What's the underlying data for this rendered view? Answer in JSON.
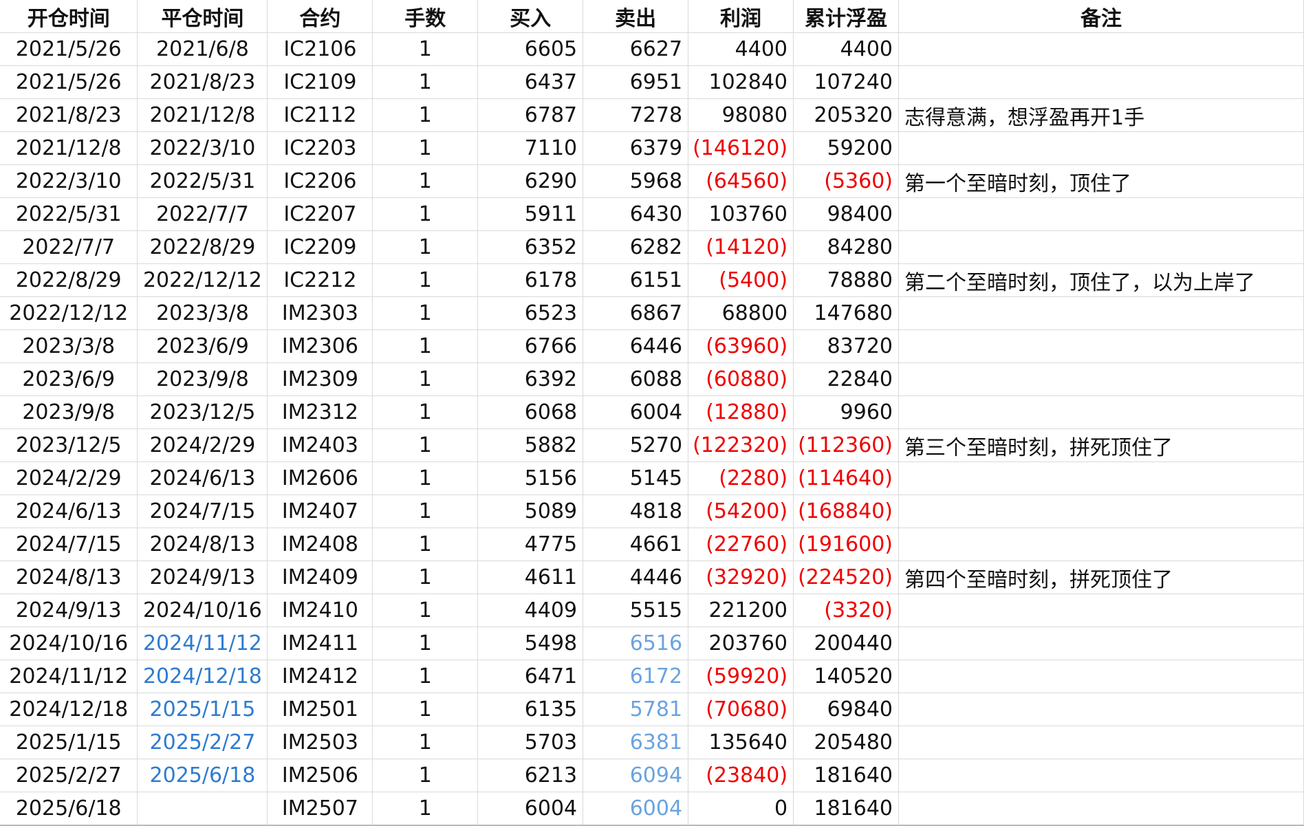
{
  "headers": [
    "开仓时间",
    "平仓时间",
    "合约",
    "手数",
    "买入",
    "卖出",
    "利润",
    "累计浮盈",
    "备注"
  ],
  "rows": [
    {
      "open": "2021/5/26",
      "close": "2021/6/8",
      "contract": "IC2106",
      "lots": "1",
      "buy": "6605",
      "sell": "6627",
      "profit": "4400",
      "cum": "4400",
      "note": ""
    },
    {
      "open": "2021/5/26",
      "close": "2021/8/23",
      "contract": "IC2109",
      "lots": "1",
      "buy": "6437",
      "sell": "6951",
      "profit": "102840",
      "cum": "107240",
      "note": ""
    },
    {
      "open": "2021/8/23",
      "close": "2021/12/8",
      "contract": "IC2112",
      "lots": "1",
      "buy": "6787",
      "sell": "7278",
      "profit": "98080",
      "cum": "205320",
      "note": "志得意满，想浮盈再开1手"
    },
    {
      "open": "2021/12/8",
      "close": "2022/3/10",
      "contract": "IC2203",
      "lots": "1",
      "buy": "7110",
      "sell": "6379",
      "profit": "(146120)",
      "cum": "59200",
      "note": ""
    },
    {
      "open": "2022/3/10",
      "close": "2022/5/31",
      "contract": "IC2206",
      "lots": "1",
      "buy": "6290",
      "sell": "5968",
      "profit": "(64560)",
      "cum": "(5360)",
      "note": "第一个至暗时刻，顶住了"
    },
    {
      "open": "2022/5/31",
      "close": "2022/7/7",
      "contract": "IC2207",
      "lots": "1",
      "buy": "5911",
      "sell": "6430",
      "profit": "103760",
      "cum": "98400",
      "note": ""
    },
    {
      "open": "2022/7/7",
      "close": "2022/8/29",
      "contract": "IC2209",
      "lots": "1",
      "buy": "6352",
      "sell": "6282",
      "profit": "(14120)",
      "cum": "84280",
      "note": ""
    },
    {
      "open": "2022/8/29",
      "close": "2022/12/12",
      "contract": "IC2212",
      "lots": "1",
      "buy": "6178",
      "sell": "6151",
      "profit": "(5400)",
      "cum": "78880",
      "note": "第二个至暗时刻，顶住了，以为上岸了"
    },
    {
      "open": "2022/12/12",
      "close": "2023/3/8",
      "contract": "IM2303",
      "lots": "1",
      "buy": "6523",
      "sell": "6867",
      "profit": "68800",
      "cum": "147680",
      "note": ""
    },
    {
      "open": "2023/3/8",
      "close": "2023/6/9",
      "contract": "IM2306",
      "lots": "1",
      "buy": "6766",
      "sell": "6446",
      "profit": "(63960)",
      "cum": "83720",
      "note": ""
    },
    {
      "open": "2023/6/9",
      "close": "2023/9/8",
      "contract": "IM2309",
      "lots": "1",
      "buy": "6392",
      "sell": "6088",
      "profit": "(60880)",
      "cum": "22840",
      "note": ""
    },
    {
      "open": "2023/9/8",
      "close": "2023/12/5",
      "contract": "IM2312",
      "lots": "1",
      "buy": "6068",
      "sell": "6004",
      "profit": "(12880)",
      "cum": "9960",
      "note": ""
    },
    {
      "open": "2023/12/5",
      "close": "2024/2/29",
      "contract": "IM2403",
      "lots": "1",
      "buy": "5882",
      "sell": "5270",
      "profit": "(122320)",
      "cum": "(112360)",
      "note": "第三个至暗时刻，拼死顶住了"
    },
    {
      "open": "2024/2/29",
      "close": "2024/6/13",
      "contract": "IM2606",
      "lots": "1",
      "buy": "5156",
      "sell": "5145",
      "profit": "(2280)",
      "cum": "(114640)",
      "note": ""
    },
    {
      "open": "2024/6/13",
      "close": "2024/7/15",
      "contract": "IM2407",
      "lots": "1",
      "buy": "5089",
      "sell": "4818",
      "profit": "(54200)",
      "cum": "(168840)",
      "note": ""
    },
    {
      "open": "2024/7/15",
      "close": "2024/8/13",
      "contract": "IM2408",
      "lots": "1",
      "buy": "4775",
      "sell": "4661",
      "profit": "(22760)",
      "cum": "(191600)",
      "note": ""
    },
    {
      "open": "2024/8/13",
      "close": "2024/9/13",
      "contract": "IM2409",
      "lots": "1",
      "buy": "4611",
      "sell": "4446",
      "profit": "(32920)",
      "cum": "(224520)",
      "note": "第四个至暗时刻，拼死顶住了"
    },
    {
      "open": "2024/9/13",
      "close": "2024/10/16",
      "contract": "IM2410",
      "lots": "1",
      "buy": "4409",
      "sell": "5515",
      "profit": "221200",
      "cum": "(3320)",
      "note": ""
    },
    {
      "open": "2024/10/16",
      "close": "2024/11/12",
      "contract": "IM2411",
      "lots": "1",
      "buy": "5498",
      "sell": "6516",
      "profit": "203760",
      "cum": "200440",
      "note": "",
      "close_blue": true,
      "sell_blue": true
    },
    {
      "open": "2024/11/12",
      "close": "2024/12/18",
      "contract": "IM2412",
      "lots": "1",
      "buy": "6471",
      "sell": "6172",
      "profit": "(59920)",
      "cum": "140520",
      "note": "",
      "close_blue": true,
      "sell_blue": true
    },
    {
      "open": "2024/12/18",
      "close": "2025/1/15",
      "contract": "IM2501",
      "lots": "1",
      "buy": "6135",
      "sell": "5781",
      "profit": "(70680)",
      "cum": "69840",
      "note": "",
      "close_blue": true,
      "sell_blue": true
    },
    {
      "open": "2025/1/15",
      "close": "2025/2/27",
      "contract": "IM2503",
      "lots": "1",
      "buy": "5703",
      "sell": "6381",
      "profit": "135640",
      "cum": "205480",
      "note": "",
      "close_blue": true,
      "sell_blue": true
    },
    {
      "open": "2025/2/27",
      "close": "2025/6/18",
      "contract": "IM2506",
      "lots": "1",
      "buy": "6213",
      "sell": "6094",
      "profit": "(23840)",
      "cum": "181640",
      "note": "",
      "close_blue": true,
      "sell_blue": true
    },
    {
      "open": "2025/6/18",
      "close": "",
      "contract": "IM2507",
      "lots": "1",
      "buy": "6004",
      "sell": "6004",
      "profit": "0",
      "cum": "181640",
      "note": "",
      "sell_blue": true
    }
  ],
  "colors": {
    "negative": "#ee0000",
    "link_blue": "#2e7bd0",
    "light_blue": "#6aa3df",
    "gridline": "#d9d9d9"
  }
}
